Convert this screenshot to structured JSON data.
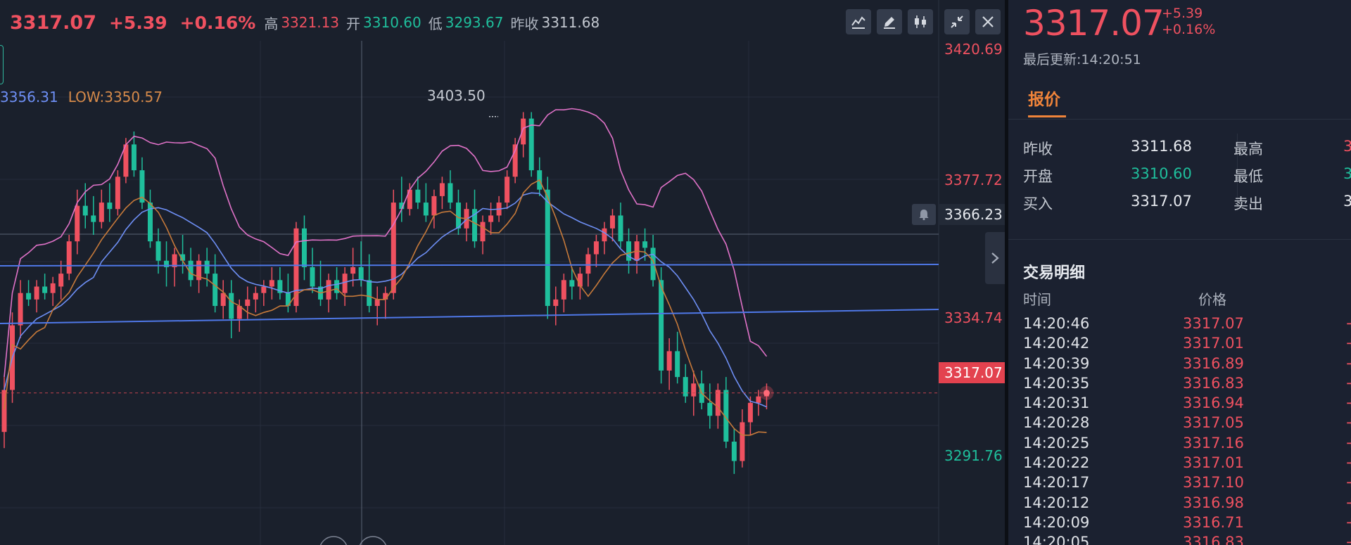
{
  "quote": {
    "last": "3317.07",
    "change": "+5.39",
    "change_pct": "+0.16%",
    "high_label": "高",
    "high": "3321.13",
    "open_label": "开",
    "open": "3310.60",
    "low_label": "低",
    "low": "3293.67",
    "prev_close_label": "昨收",
    "prev_close": "3311.68"
  },
  "toolbar": {
    "icons": [
      "indicator-line-icon",
      "draw-pen-icon",
      "candlestick-type-icon",
      "shrink-icon",
      "close-icon"
    ]
  },
  "overlay": {
    "channel_high_label": "3356.31",
    "channel_low_label": "LOW:3350.57",
    "peak_label": "3403.50",
    "crosshair_price": "3366.23",
    "current_price": "3317.07"
  },
  "colors": {
    "up": "#ef5160",
    "down": "#1fbf9c",
    "boll_upper": "#e072c8",
    "boll_mid": "#6e8ff5",
    "ma": "#c77a3a",
    "trendline": "#4f78e8",
    "background": "#1a202c"
  },
  "chart_data": {
    "type": "candlestick",
    "y_axis_ticks": [
      {
        "value": "3420.69",
        "color": "red"
      },
      {
        "value": "3377.72",
        "color": "red"
      },
      {
        "value": "3334.74",
        "color": "red"
      },
      {
        "value": "3291.76",
        "color": "green"
      }
    ],
    "ylim": [
      3270,
      3430
    ],
    "candles_ohlc": [
      [
        3305,
        3322,
        3300,
        3318
      ],
      [
        3318,
        3342,
        3314,
        3338
      ],
      [
        3338,
        3352,
        3334,
        3348
      ],
      [
        3348,
        3352,
        3344,
        3346
      ],
      [
        3346,
        3352,
        3342,
        3350
      ],
      [
        3350,
        3354,
        3346,
        3348
      ],
      [
        3348,
        3353,
        3344,
        3351
      ],
      [
        3350,
        3358,
        3346,
        3354
      ],
      [
        3354,
        3366,
        3352,
        3364
      ],
      [
        3364,
        3380,
        3360,
        3375
      ],
      [
        3375,
        3382,
        3368,
        3372
      ],
      [
        3372,
        3378,
        3366,
        3370
      ],
      [
        3370,
        3380,
        3368,
        3376
      ],
      [
        3376,
        3382,
        3370,
        3374
      ],
      [
        3374,
        3386,
        3372,
        3384
      ],
      [
        3384,
        3396,
        3382,
        3394
      ],
      [
        3394,
        3398,
        3384,
        3386
      ],
      [
        3386,
        3390,
        3374,
        3376
      ],
      [
        3376,
        3380,
        3362,
        3364
      ],
      [
        3364,
        3368,
        3354,
        3358
      ],
      [
        3358,
        3364,
        3350,
        3356
      ],
      [
        3356,
        3362,
        3350,
        3360
      ],
      [
        3360,
        3366,
        3354,
        3358
      ],
      [
        3358,
        3362,
        3350,
        3352
      ],
      [
        3352,
        3360,
        3348,
        3358
      ],
      [
        3358,
        3362,
        3350,
        3354
      ],
      [
        3354,
        3360,
        3342,
        3344
      ],
      [
        3344,
        3352,
        3340,
        3348
      ],
      [
        3348,
        3352,
        3334,
        3340
      ],
      [
        3340,
        3346,
        3336,
        3344
      ],
      [
        3344,
        3350,
        3340,
        3346
      ],
      [
        3346,
        3350,
        3342,
        3348
      ],
      [
        3348,
        3352,
        3344,
        3350
      ],
      [
        3350,
        3356,
        3346,
        3352
      ],
      [
        3352,
        3356,
        3346,
        3348
      ],
      [
        3348,
        3354,
        3342,
        3344
      ],
      [
        3344,
        3370,
        3342,
        3368
      ],
      [
        3368,
        3372,
        3352,
        3356
      ],
      [
        3356,
        3362,
        3348,
        3350
      ],
      [
        3350,
        3358,
        3344,
        3346
      ],
      [
        3346,
        3354,
        3342,
        3352
      ],
      [
        3352,
        3356,
        3346,
        3348
      ],
      [
        3348,
        3356,
        3344,
        3354
      ],
      [
        3354,
        3362,
        3350,
        3356
      ],
      [
        3356,
        3364,
        3350,
        3352
      ],
      [
        3352,
        3360,
        3342,
        3344
      ],
      [
        3344,
        3350,
        3338,
        3346
      ],
      [
        3346,
        3350,
        3340,
        3348
      ],
      [
        3348,
        3380,
        3346,
        3376
      ],
      [
        3376,
        3384,
        3370,
        3374
      ],
      [
        3374,
        3382,
        3372,
        3380
      ],
      [
        3380,
        3384,
        3374,
        3376
      ],
      [
        3376,
        3382,
        3370,
        3372
      ],
      [
        3372,
        3380,
        3368,
        3378
      ],
      [
        3378,
        3384,
        3374,
        3382
      ],
      [
        3382,
        3386,
        3374,
        3376
      ],
      [
        3376,
        3380,
        3366,
        3368
      ],
      [
        3368,
        3376,
        3364,
        3374
      ],
      [
        3374,
        3380,
        3362,
        3364
      ],
      [
        3364,
        3372,
        3360,
        3370
      ],
      [
        3370,
        3376,
        3366,
        3372
      ],
      [
        3372,
        3378,
        3370,
        3376
      ],
      [
        3376,
        3386,
        3374,
        3384
      ],
      [
        3384,
        3396,
        3382,
        3394
      ],
      [
        3394,
        3404,
        3390,
        3402
      ],
      [
        3402,
        3404,
        3384,
        3386
      ],
      [
        3386,
        3390,
        3378,
        3380
      ],
      [
        3380,
        3384,
        3340,
        3344
      ],
      [
        3344,
        3350,
        3338,
        3346
      ],
      [
        3346,
        3354,
        3342,
        3352
      ],
      [
        3352,
        3356,
        3346,
        3350
      ],
      [
        3350,
        3356,
        3346,
        3354
      ],
      [
        3354,
        3362,
        3350,
        3360
      ],
      [
        3360,
        3366,
        3356,
        3364
      ],
      [
        3364,
        3370,
        3360,
        3368
      ],
      [
        3368,
        3374,
        3364,
        3372
      ],
      [
        3372,
        3376,
        3362,
        3364
      ],
      [
        3364,
        3368,
        3354,
        3358
      ],
      [
        3358,
        3366,
        3354,
        3364
      ],
      [
        3364,
        3368,
        3358,
        3362
      ],
      [
        3362,
        3366,
        3350,
        3352
      ],
      [
        3352,
        3356,
        3320,
        3324
      ],
      [
        3324,
        3334,
        3318,
        3330
      ],
      [
        3330,
        3336,
        3320,
        3322
      ],
      [
        3322,
        3326,
        3314,
        3316
      ],
      [
        3316,
        3324,
        3310,
        3320
      ],
      [
        3320,
        3324,
        3312,
        3314
      ],
      [
        3314,
        3320,
        3306,
        3310
      ],
      [
        3310,
        3320,
        3306,
        3318
      ],
      [
        3318,
        3322,
        3300,
        3302
      ],
      [
        3302,
        3306,
        3292,
        3296
      ],
      [
        3296,
        3312,
        3294,
        3308
      ],
      [
        3308,
        3316,
        3304,
        3314
      ],
      [
        3314,
        3318,
        3310,
        3316
      ],
      [
        3316,
        3320,
        3312,
        3317.07
      ]
    ],
    "peak_value": 3403.5,
    "current_value": 3317.07,
    "crosshair_value": 3366.23
  },
  "side": {
    "price": "3317.07",
    "change": "+5.39",
    "change_pct": "+0.16%",
    "updated_label": "最后更新:",
    "updated_time": "14:20:51",
    "tab_quote": "报价",
    "stats": {
      "prev_close_label": "昨收",
      "prev_close": "3311.68",
      "open_label": "开盘",
      "open": "3310.60",
      "bid_label": "买入",
      "bid": "3317.07",
      "high_label": "最高",
      "high_partial": "3",
      "low_label": "最低",
      "low_partial": "3",
      "ask_label": "卖出",
      "ask_partial": "3"
    },
    "trades_title": "交易明细",
    "trades_head_time": "时间",
    "trades_head_price": "价格",
    "trades": [
      {
        "time": "14:20:46",
        "price": "3317.07",
        "side": "+"
      },
      {
        "time": "14:20:42",
        "price": "3317.01",
        "side": "+"
      },
      {
        "time": "14:20:39",
        "price": "3316.89",
        "side": "+"
      },
      {
        "time": "14:20:35",
        "price": "3316.83",
        "side": "+"
      },
      {
        "time": "14:20:31",
        "price": "3316.94",
        "side": "+"
      },
      {
        "time": "14:20:28",
        "price": "3317.05",
        "side": "+"
      },
      {
        "time": "14:20:25",
        "price": "3317.16",
        "side": "+"
      },
      {
        "time": "14:20:22",
        "price": "3317.01",
        "side": "+"
      },
      {
        "time": "14:20:17",
        "price": "3317.10",
        "side": "+"
      },
      {
        "time": "14:20:12",
        "price": "3316.98",
        "side": "+"
      },
      {
        "time": "14:20:09",
        "price": "3316.71",
        "side": "+"
      },
      {
        "time": "14:20:05",
        "price": "3316.83",
        "side": "+"
      }
    ]
  }
}
